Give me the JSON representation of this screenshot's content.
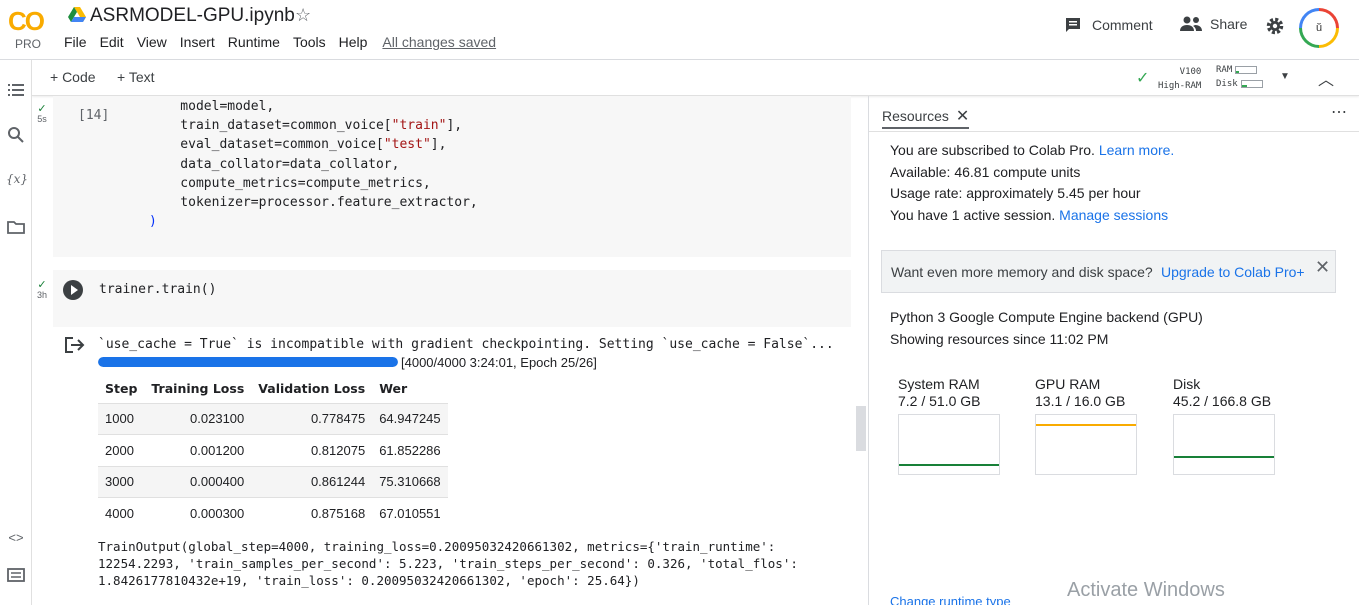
{
  "app": {
    "logo_text": "CO",
    "plan": "PRO",
    "notebook_title": "ASRMODEL-GPU.ipynb",
    "menu": [
      "File",
      "Edit",
      "View",
      "Insert",
      "Runtime",
      "Tools",
      "Help"
    ],
    "save_status": "All changes saved",
    "comment_label": "Comment",
    "share_label": "Share",
    "avatar_initial": "ŭ"
  },
  "toolbar": {
    "add_code": "+ Code",
    "add_text": "+ Text",
    "runtime_gpu": "V100",
    "runtime_type": "High-RAM",
    "ram_label": "RAM",
    "disk_label": "Disk"
  },
  "cells": {
    "cell1": {
      "exec_count": "[14]",
      "duration": "5s",
      "code_lines": [
        "    model=model,",
        "    train_dataset=common_voice[\"train\"],",
        "    eval_dataset=common_voice[\"test\"],",
        "    data_collator=data_collator,",
        "    compute_metrics=compute_metrics,",
        "    tokenizer=processor.feature_extractor,",
        ")"
      ]
    },
    "cell2": {
      "duration": "3h",
      "code": "trainer.train()",
      "warning": "`use_cache = True` is incompatible with gradient checkpointing. Setting `use_cache = False`...",
      "progress_fraction": 1.0,
      "progress_text": "[4000/4000 3:24:01, Epoch 25/26]",
      "table": {
        "headers": [
          "Step",
          "Training Loss",
          "Validation Loss",
          "Wer"
        ],
        "rows": [
          [
            "1000",
            "0.023100",
            "0.778475",
            "64.947245"
          ],
          [
            "2000",
            "0.001200",
            "0.812075",
            "61.852286"
          ],
          [
            "3000",
            "0.000400",
            "0.861244",
            "75.310668"
          ],
          [
            "4000",
            "0.000300",
            "0.875168",
            "67.010551"
          ]
        ]
      },
      "train_output_lines": [
        "TrainOutput(global_step=4000, training_loss=0.20095032420661302, metrics={'train_runtime':",
        "12254.2293, 'train_samples_per_second': 5.223, 'train_steps_per_second': 0.326, 'total_flos':",
        "1.8426177810432e+19, 'train_loss': 0.20095032420661302, 'epoch': 25.64})"
      ]
    }
  },
  "resources": {
    "tab_label": "Resources",
    "subscribed": "You are subscribed to Colab Pro.",
    "learn_more": "Learn more.",
    "available": "Available: 46.81 compute units",
    "usage_rate": "Usage rate: approximately 5.45 per hour",
    "sessions": "You have 1 active session.",
    "manage_sessions": "Manage sessions",
    "upgrade_msg": "Want even more memory and disk space?",
    "upgrade_link": "Upgrade to Colab Pro+",
    "backend": "Python 3 Google Compute Engine backend (GPU)",
    "since": "Showing resources since 11:02 PM",
    "gauges": [
      {
        "name": "System RAM",
        "value": "7.2 / 51.0 GB",
        "fraction": 0.14,
        "color": "#188038"
      },
      {
        "name": "GPU RAM",
        "value": "13.1 / 16.0 GB",
        "fraction": 0.82,
        "color": "#f9ab00"
      },
      {
        "name": "Disk",
        "value": "45.2 / 166.8 GB",
        "fraction": 0.27,
        "color": "#188038"
      }
    ],
    "change_runtime": "Change runtime type",
    "watermark": "Activate Windows"
  }
}
